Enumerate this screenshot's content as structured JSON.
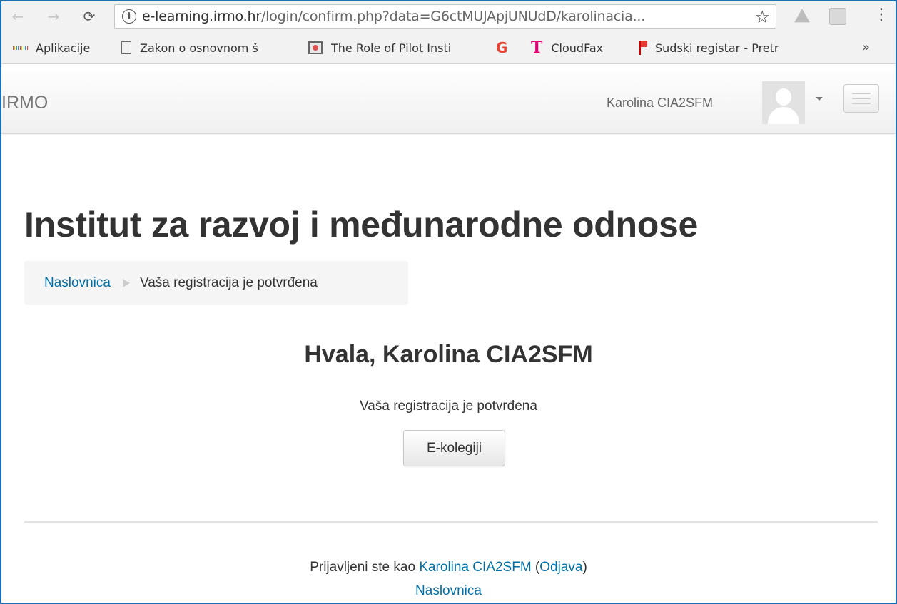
{
  "browser": {
    "url_host": "e-learning.irmo.hr",
    "url_path": "/login/confirm.php?data=G6ctMUJApjUNUdD/karolinacia...",
    "icons": {
      "back": "arrow-left-icon",
      "forward": "arrow-right-icon",
      "reload": "reload-icon",
      "info": "info-icon",
      "star": "star-icon",
      "menu": "more-vertical-icon"
    },
    "bookmarks": [
      {
        "label": "Aplikacije",
        "icon": "apps-icon"
      },
      {
        "label": "Zakon o osnovnom š",
        "icon": "page-icon"
      },
      {
        "label": "The Role of Pilot Insti",
        "icon": "presentation-icon"
      },
      {
        "label": "",
        "icon": "google-icon"
      },
      {
        "label": "CloudFax",
        "icon": "telekom-icon"
      },
      {
        "label": "Sudski registar - Pretr",
        "icon": "flag-icon"
      }
    ],
    "overflow_label": "»",
    "accent_color": "#1f6fb2"
  },
  "navbar": {
    "brand": "IRMO",
    "user_name": "Karolina CIA2SFM"
  },
  "page": {
    "title": "Institut za razvoj i međunarodne odnose",
    "breadcrumb": {
      "home": "Naslovnica",
      "current": "Vaša registracija je potvrđena"
    },
    "greeting": "Hvala, Karolina CIA2SFM",
    "message": "Vaša registracija je potvrđena",
    "courses_button": "E-kolegiji"
  },
  "footer": {
    "logged_in_prefix": "Prijavljeni ste kao ",
    "user_link": "Karolina CIA2SFM",
    "paren_open": " (",
    "logout": "Odjava",
    "paren_close": ")",
    "home": "Naslovnica",
    "link_color": "#0070a8"
  }
}
